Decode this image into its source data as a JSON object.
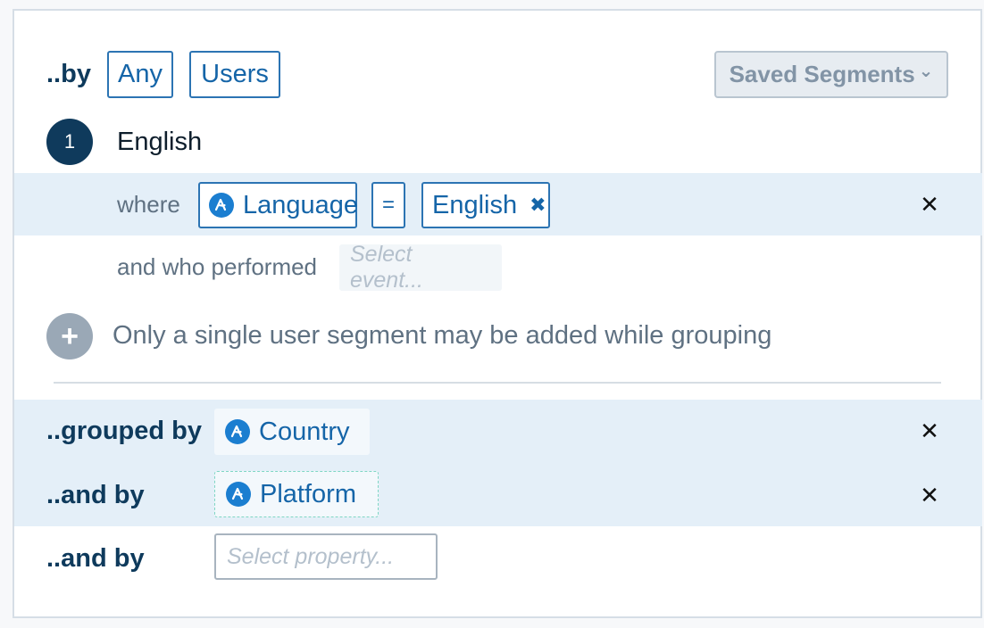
{
  "segment": {
    "by_label": "..by",
    "any_label": "Any",
    "users_label": "Users",
    "saved_segments_label": "Saved Segments",
    "saved_segments_caret": "⌄",
    "step_number": "1",
    "segment_name": "English",
    "where_label": "where",
    "property_label": "Language",
    "operator_label": "=",
    "value_label": "English",
    "value_remove": "✖",
    "remove_row": "✕",
    "performed_label": "and who performed",
    "event_placeholder": "Select event...",
    "add_icon": "+",
    "add_notice": "Only a single user segment may be added while grouping"
  },
  "grouping": {
    "grouped_by_label": "..grouped by",
    "group1_property": "Country",
    "and_by_label_1": "..and by",
    "group2_property": "Platform",
    "and_by_label_2": "..and by",
    "property_placeholder": "Select property...",
    "remove_row": "✕"
  },
  "colors": {
    "accent": "#1565a8",
    "dark_navy": "#0f3a5c",
    "row_highlight": "#e4eff8"
  }
}
